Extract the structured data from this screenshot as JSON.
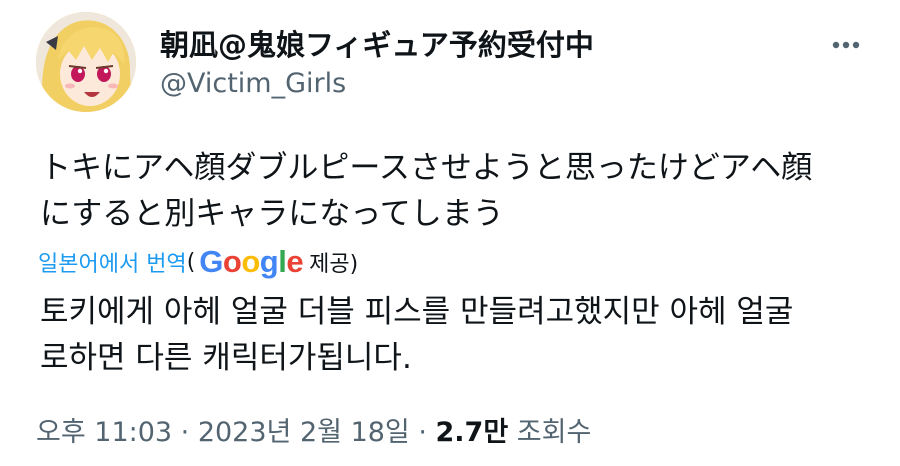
{
  "tweet": {
    "display_name": "朝凪@鬼娘フィギュア予約受付中",
    "handle": "@Victim_Girls",
    "text_lines": [
      "トキにアヘ顔ダブルピースさせようと思ったけどアヘ顔",
      "にすると別キャラになってしまう"
    ],
    "translate": {
      "link_text": "일본어에서 번역",
      "open_paren": "(",
      "provider_letters": [
        "G",
        "o",
        "o",
        "g",
        "l",
        "e"
      ],
      "provided_by": "제공)"
    },
    "translated_lines": [
      "토키에게 아헤 얼굴 더블 피스를 만들려고했지만 아헤 얼굴",
      "로하면 다른 캐릭터가됩니다."
    ],
    "meta": {
      "time": "오후 11:03",
      "separator": " · ",
      "date": "2023년 2월 18일",
      "views_count": "2.7만",
      "views_label": "조회수"
    }
  },
  "colors": {
    "text": "#0f1419",
    "secondary": "#536471",
    "link": "#1d9bf0",
    "google_blue": "#4285f4",
    "google_red": "#ea4335",
    "google_yellow": "#fbbc05",
    "google_green": "#34a853"
  },
  "icons": {
    "avatar": "anime-girl-avatar",
    "more": "more-horizontal-icon"
  }
}
